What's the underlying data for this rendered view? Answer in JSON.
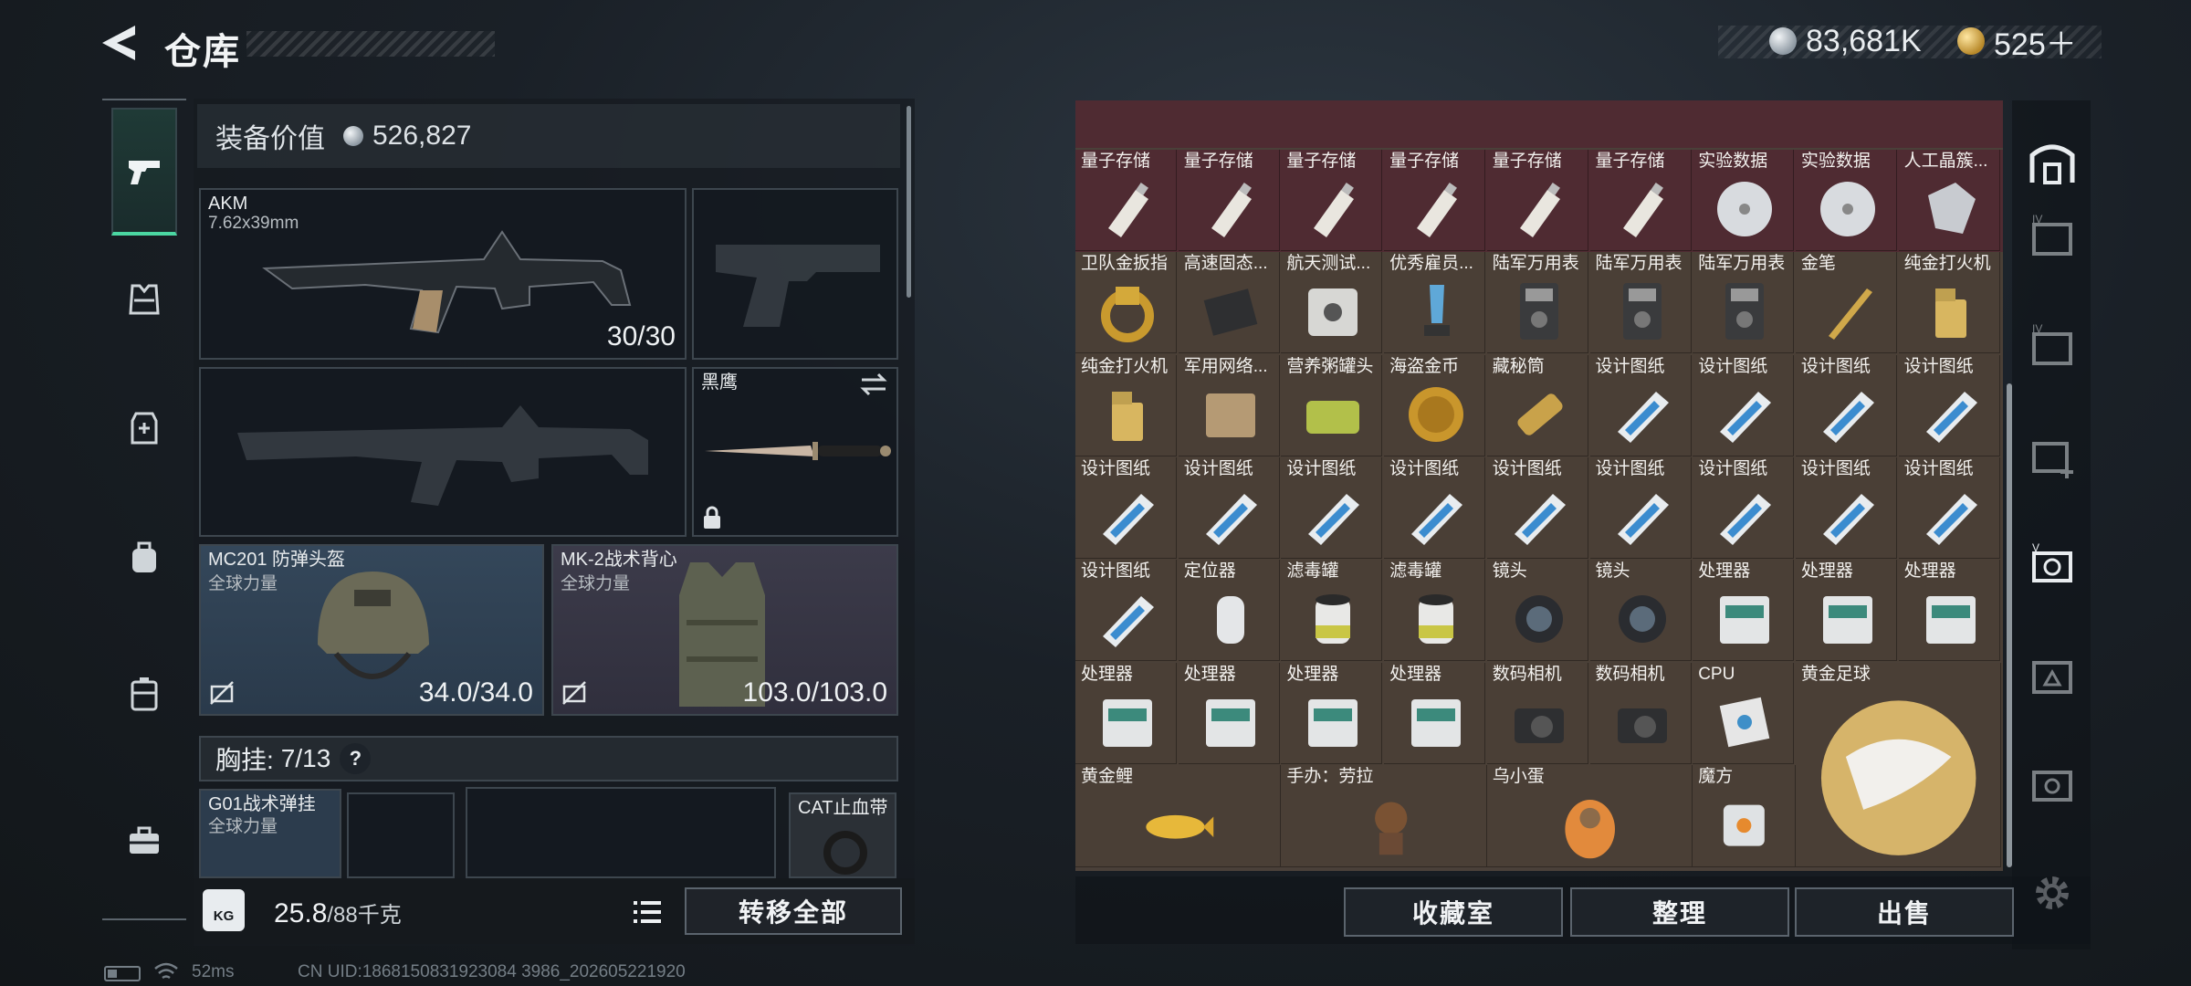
{
  "header": {
    "title": "仓库",
    "back_icon": "back-arrow-icon"
  },
  "currency": {
    "silver": "83,681K",
    "gold": "525＋"
  },
  "nav": [
    "pistol-icon",
    "chest-rig-icon",
    "armor-icon",
    "backpack-icon",
    "safe-case-icon",
    "toolbox-icon"
  ],
  "equipment": {
    "value_label": "装备价值",
    "value": "526,827",
    "primary": {
      "name": "AKM",
      "ammo_type": "7.62x39mm",
      "ammo": "30/30"
    },
    "melee": {
      "name": "黑鹰"
    },
    "helmet": {
      "name": "MC201 防弹头盔",
      "faction": "全球力量",
      "durability": "34.0/34.0"
    },
    "vest": {
      "name": "MK-2战术背心",
      "faction": "全球力量",
      "durability": "103.0/103.0"
    },
    "chest_rig": {
      "label": "胸挂:",
      "used": "7",
      "capacity": "/13",
      "help": "?"
    },
    "rig_items": [
      {
        "name": "G01战术弹挂",
        "faction": "全球力量"
      },
      {
        "name": "CAT止血带"
      }
    ],
    "weight": "25.8",
    "weight_max": "/88千克",
    "kg_label": "KG",
    "transfer_all": "转移全部"
  },
  "status": {
    "ping": "52ms",
    "uid": "CN UID:1868150831923084 3986_202605221920"
  },
  "inventory": {
    "rows": [
      {
        "bg": "red",
        "items": [
          "量子存储",
          "量子存储",
          "量子存储",
          "量子存储",
          "量子存储",
          "量子存储",
          "实验数据",
          "实验数据",
          "人工晶簇..."
        ]
      },
      {
        "bg": "brown",
        "items": [
          "卫队金扳指",
          "高速固态...",
          "航天测试...",
          "优秀雇员...",
          "陆军万用表",
          "陆军万用表",
          "陆军万用表",
          "金笔",
          "纯金打火机"
        ]
      },
      {
        "bg": "brown",
        "items": [
          "纯金打火机",
          "军用网络...",
          "营养粥罐头",
          "海盗金币",
          "藏秘筒",
          "设计图纸",
          "设计图纸",
          "设计图纸",
          "设计图纸"
        ]
      },
      {
        "bg": "brown",
        "items": [
          "设计图纸",
          "设计图纸",
          "设计图纸",
          "设计图纸",
          "设计图纸",
          "设计图纸",
          "设计图纸",
          "设计图纸",
          "设计图纸"
        ]
      },
      {
        "bg": "brown",
        "items": [
          "设计图纸",
          "定位器",
          "滤毒罐",
          "滤毒罐",
          "镜头",
          "镜头",
          "处理器",
          "处理器",
          "处理器"
        ]
      },
      {
        "bg": "brown",
        "items": [
          "处理器",
          "处理器",
          "处理器",
          "处理器",
          "数码相机",
          "数码相机",
          "CPU"
        ]
      }
    ],
    "big_items": [
      {
        "name": "黄金足球"
      },
      {
        "name": "黄金鲤"
      },
      {
        "name": "手办：劳拉"
      },
      {
        "name": "乌小蛋"
      },
      {
        "name": "魔方"
      }
    ]
  },
  "actions": {
    "collection": "收藏室",
    "sort": "整理",
    "sell": "出售"
  },
  "right_tabs": [
    "shelter-icon",
    "storage-iv-icon",
    "storage-iv-icon",
    "storage-add-icon",
    "storage-v-icon",
    "storage-iv-icon",
    "storage-v-icon",
    "settings-icon"
  ],
  "colors": {
    "accent": "#4bd7a2",
    "red_cell": "#4f2b32",
    "brown_cell": "#4a3f36"
  }
}
